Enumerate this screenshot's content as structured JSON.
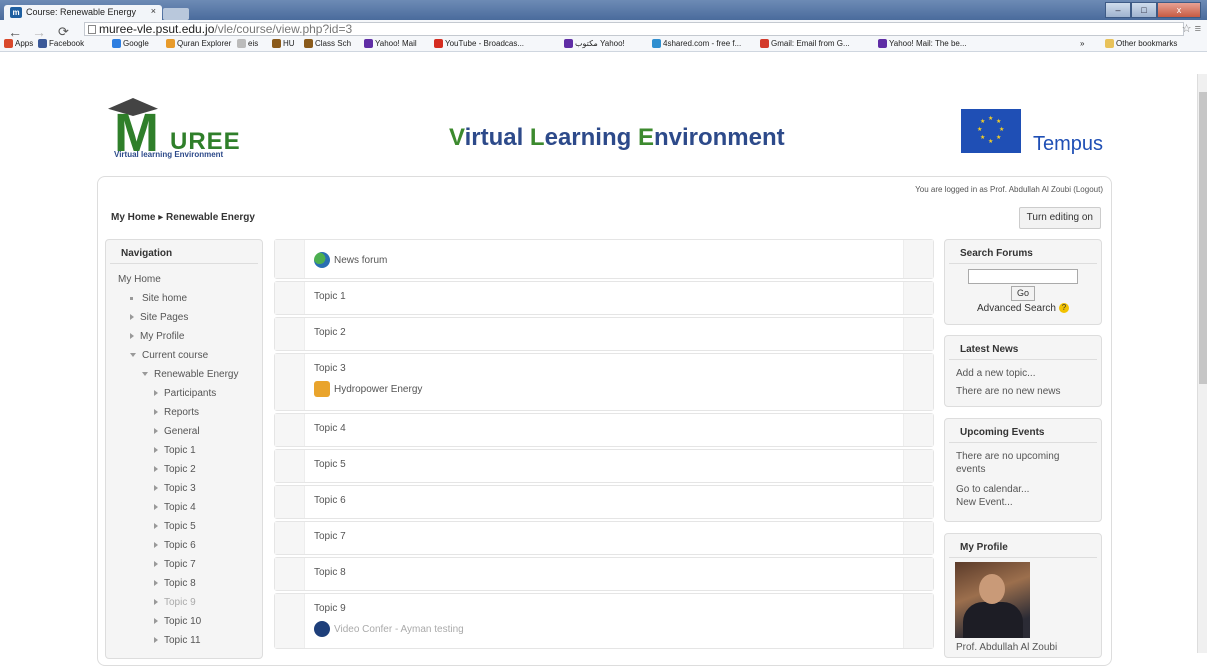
{
  "browser": {
    "tab_title": "Course: Renewable Energy",
    "tab_close": "×",
    "url_host": "muree-vle.psut.edu.jo",
    "url_path": "/vle/course/view.php?id=3",
    "window_buttons": [
      "–",
      "□",
      "x"
    ],
    "bookmarks": [
      {
        "label": "Apps",
        "icon": "apps-icon",
        "color": "#d9482b"
      },
      {
        "label": "Facebook",
        "icon": "facebook-icon",
        "color": "#3b5998"
      },
      {
        "label": "Google",
        "icon": "google-icon",
        "color": "#2d7ee0"
      },
      {
        "label": "Quran Explorer",
        "icon": "quran-icon",
        "color": "#e89b2b"
      },
      {
        "label": "eis",
        "icon": "page-icon",
        "color": "#bbbbbb"
      },
      {
        "label": "HU",
        "icon": "hu-icon",
        "color": "#8a5a1b"
      },
      {
        "label": "Class Sch",
        "icon": "class-icon",
        "color": "#8a5a1b"
      },
      {
        "label": "Yahoo! Mail",
        "icon": "yahoo-icon",
        "color": "#5f2da5"
      },
      {
        "label": "YouTube - Broadcas...",
        "icon": "youtube-icon",
        "color": "#d52c20"
      },
      {
        "label": "مكتوب Yahoo!",
        "icon": "yahoo-icon",
        "color": "#5f2da5"
      },
      {
        "label": "4shared.com - free f...",
        "icon": "fourshared-icon",
        "color": "#2f8fd0"
      },
      {
        "label": "Gmail: Email from G...",
        "icon": "gmail-icon",
        "color": "#d33a2b"
      },
      {
        "label": "Yahoo! Mail: The be...",
        "icon": "yahoo-icon",
        "color": "#5f2da5"
      }
    ],
    "other_bookmarks": "Other bookmarks",
    "chevron": "»"
  },
  "header": {
    "logo_m": "M",
    "logo_ree": "UREE",
    "logo_sub": "Virtual learning Environment",
    "title_parts": [
      "V",
      "irtual ",
      "L",
      "earning ",
      "E",
      "nvironment"
    ],
    "tempus": "Tempus"
  },
  "page": {
    "login_text": "You are logged in as Prof. Abdullah Al Zoubi (Logout)",
    "breadcrumb": "My Home ▸ Renewable Energy",
    "turn_editing": "Turn editing on"
  },
  "navigation": {
    "title": "Navigation",
    "items": [
      {
        "label": "My Home",
        "kind": "none",
        "indent": 0
      },
      {
        "label": "Site home",
        "kind": "square",
        "indent": 1
      },
      {
        "label": "Site Pages",
        "kind": "closed",
        "indent": 1
      },
      {
        "label": "My Profile",
        "kind": "closed",
        "indent": 1
      },
      {
        "label": "Current course",
        "kind": "open",
        "indent": 1
      },
      {
        "label": "Renewable Energy",
        "kind": "open",
        "indent": 2
      },
      {
        "label": "Participants",
        "kind": "closed",
        "indent": 3
      },
      {
        "label": "Reports",
        "kind": "closed",
        "indent": 3
      },
      {
        "label": "General",
        "kind": "closed",
        "indent": 3
      },
      {
        "label": "Topic 1",
        "kind": "closed",
        "indent": 3
      },
      {
        "label": "Topic 2",
        "kind": "closed",
        "indent": 3
      },
      {
        "label": "Topic 3",
        "kind": "closed",
        "indent": 3
      },
      {
        "label": "Topic 4",
        "kind": "closed",
        "indent": 3
      },
      {
        "label": "Topic 5",
        "kind": "closed",
        "indent": 3
      },
      {
        "label": "Topic 6",
        "kind": "closed",
        "indent": 3
      },
      {
        "label": "Topic 7",
        "kind": "closed",
        "indent": 3
      },
      {
        "label": "Topic 8",
        "kind": "closed",
        "indent": 3
      },
      {
        "label": "Topic 9",
        "kind": "closed",
        "indent": 3,
        "dim": true
      },
      {
        "label": "Topic 10",
        "kind": "closed",
        "indent": 3
      },
      {
        "label": "Topic 11",
        "kind": "closed",
        "indent": 3
      }
    ]
  },
  "sections": [
    {
      "title": "",
      "activities": [
        {
          "label": "News forum",
          "icon": "forum-icon"
        }
      ]
    },
    {
      "title": "Topic 1",
      "activities": []
    },
    {
      "title": "Topic 2",
      "activities": []
    },
    {
      "title": "Topic 3",
      "activities": [
        {
          "label": "Hydropower Energy",
          "icon": "package-icon"
        }
      ]
    },
    {
      "title": "Topic 4",
      "activities": []
    },
    {
      "title": "Topic 5",
      "activities": []
    },
    {
      "title": "Topic 6",
      "activities": []
    },
    {
      "title": "Topic 7",
      "activities": []
    },
    {
      "title": "Topic 8",
      "activities": []
    },
    {
      "title": "Topic 9",
      "activities": [
        {
          "label": "Video Confer - Ayman testing",
          "icon": "bigbluebutton-icon",
          "dim": true
        }
      ]
    }
  ],
  "search_forums": {
    "title": "Search Forums",
    "go": "Go",
    "advanced": "Advanced Search",
    "help": "?"
  },
  "latest_news": {
    "title": "Latest News",
    "add": "Add a new topic...",
    "none": "There are no new news"
  },
  "upcoming": {
    "title": "Upcoming Events",
    "none": "There are no upcoming events",
    "calendar": "Go to calendar...",
    "new_event": "New Event..."
  },
  "profile": {
    "title": "My Profile",
    "name": "Prof. Abdullah Al Zoubi"
  }
}
